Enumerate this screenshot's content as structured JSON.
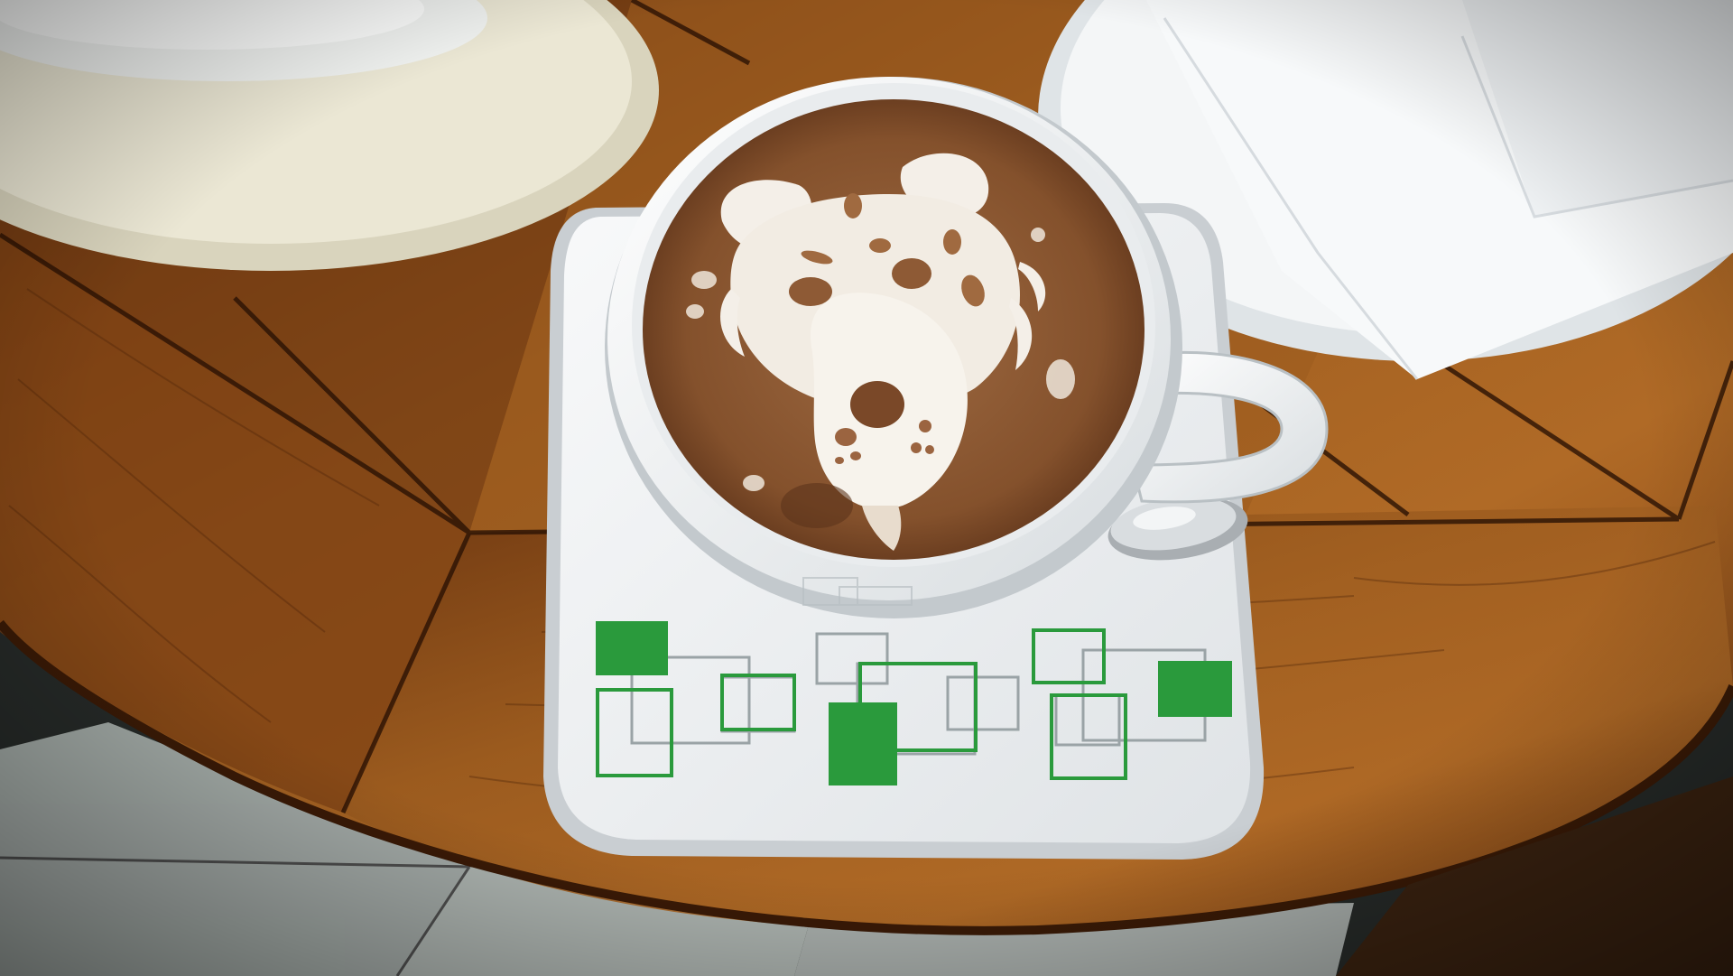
{
  "colors": {
    "floor": "#2a2e2c",
    "floor_tile": "#c9cfcc",
    "wood_dark": "#5a2e0c",
    "wood_mid": "#8a4c18",
    "wood_light": "#b8742c",
    "plate_cream": "#e9e5d2",
    "plate_white": "#f2f4f5",
    "napkin": "#f4f6f8",
    "saucer": "#f3f4f6",
    "cup": "#f6f7f8",
    "coffee": "#8e5a35",
    "coffee_dark": "#5c331a",
    "foam": "#f4efe8",
    "pattern_green": "#2a9a3c",
    "pattern_grey": "#9aa3a6",
    "spoon": "#c8ccd0"
  },
  "scene": {
    "description_icons": [
      "coffee-cup-icon",
      "saucer-icon",
      "spoon-icon",
      "plate-icon",
      "napkin-icon"
    ]
  }
}
